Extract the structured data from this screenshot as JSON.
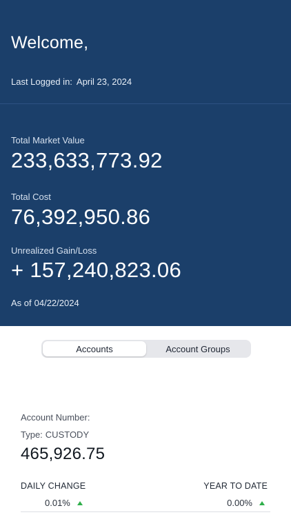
{
  "header": {
    "welcome": "Welcome,",
    "last_logged_label": "Last Logged in:",
    "last_logged_date": "April 23, 2024"
  },
  "summary": {
    "total_market_value_label": "Total Market Value",
    "total_market_value": "233,633,773.92",
    "total_cost_label": "Total Cost",
    "total_cost": "76,392,950.86",
    "unrealized_label": "Unrealized Gain/Loss",
    "unrealized_value": "+ 157,240,823.06",
    "as_of_label": "As of",
    "as_of_date": "04/22/2024"
  },
  "tabs": {
    "accounts": "Accounts",
    "account_groups": "Account Groups",
    "selected": "Accounts"
  },
  "account": {
    "number_label": "Account Number:",
    "type_label": "Type:",
    "type_value": "CUSTODY",
    "value": "465,926.75",
    "daily_change_label": "DAILY CHANGE",
    "daily_change_value": "0.01%",
    "ytd_label": "YEAR TO DATE",
    "ytd_value": "0.00%"
  },
  "colors": {
    "brand_navy": "#1b3f6a",
    "up_green": "#2fae4a"
  }
}
